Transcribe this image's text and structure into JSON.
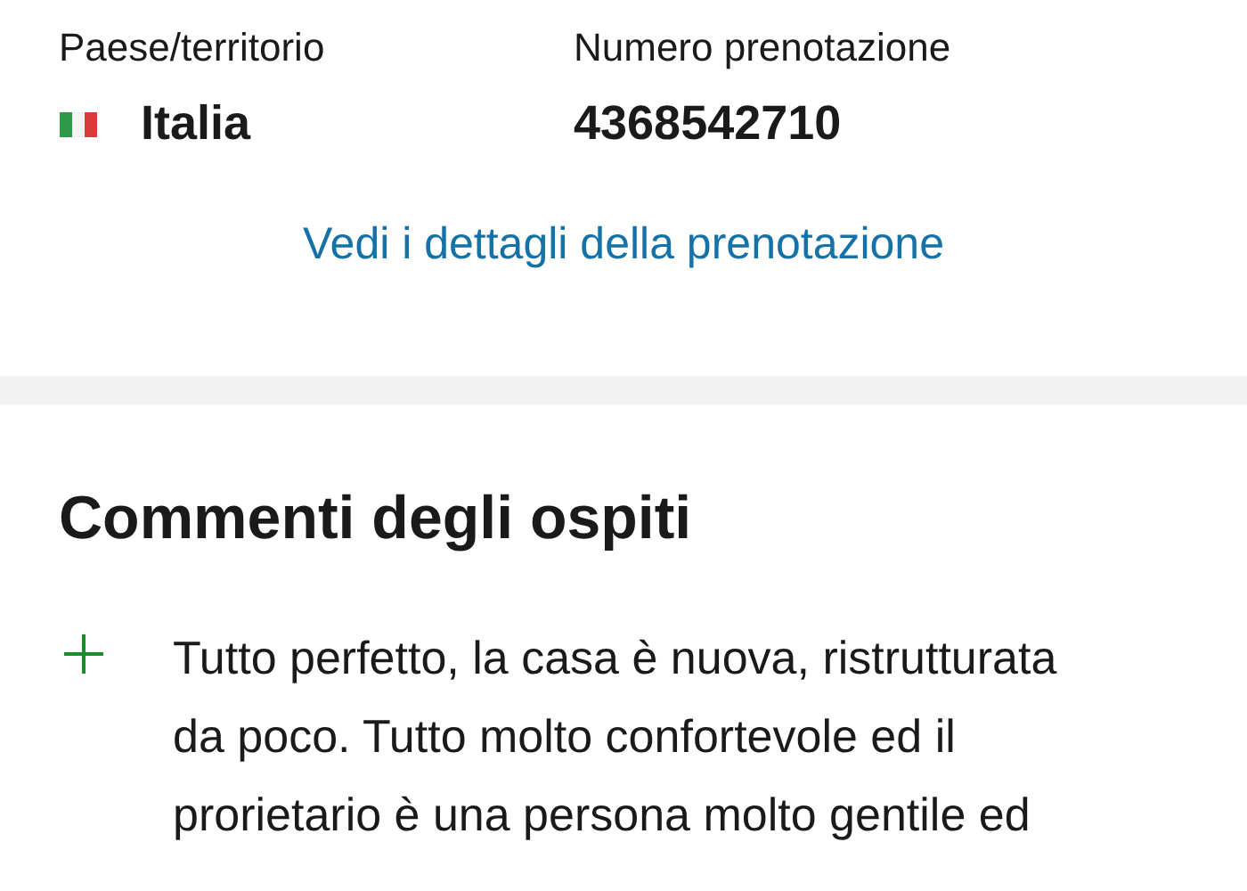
{
  "booking": {
    "country_label": "Paese/territorio",
    "country": "Italia",
    "number_label": "Numero prenotazione",
    "number": "4368542710",
    "details_link": "Vedi i dettagli della prenotazione"
  },
  "comments": {
    "title": "Commenti degli ospiti",
    "items": [
      {
        "kind": "positive",
        "text": "Tutto perfetto, la casa è nuova, ristrutturata da poco. Tutto molto confortevole ed il prorietario è una persona molto gentile ed"
      }
    ]
  }
}
